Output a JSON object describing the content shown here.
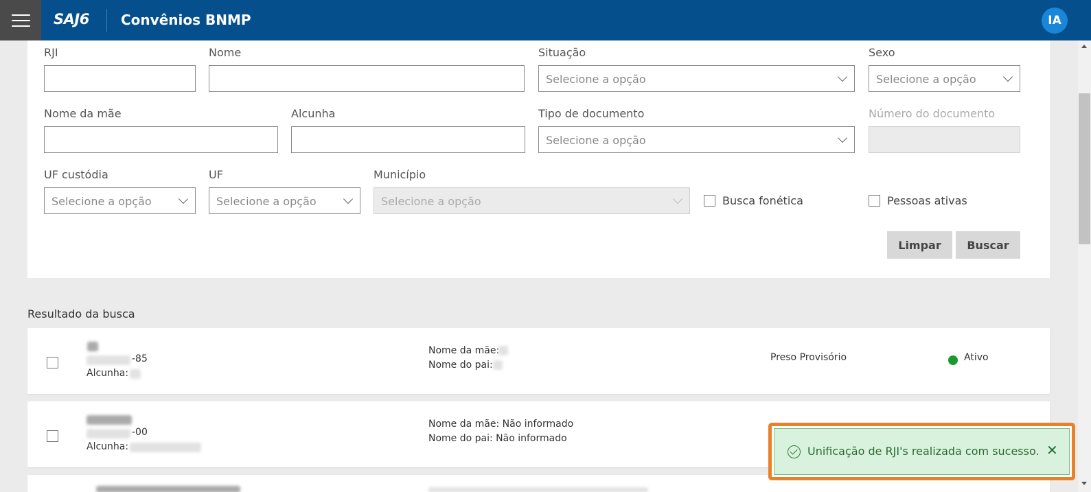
{
  "header": {
    "logo": "SAJ6",
    "title": "Convênios BNMP",
    "avatar_initials": "IA"
  },
  "filters": {
    "rji_label": "RJI",
    "nome_label": "Nome",
    "situacao_label": "Situação",
    "situacao_value": "Selecione a opção",
    "sexo_label": "Sexo",
    "sexo_value": "Selecione a opção",
    "nome_mae_label": "Nome da mãe",
    "alcunha_label": "Alcunha",
    "tipo_documento_label": "Tipo de documento",
    "tipo_documento_value": "Selecione a opção",
    "numero_documento_label": "Número do documento",
    "uf_custodia_label": "UF custódia",
    "uf_custodia_value": "Selecione a opção",
    "uf_label": "UF",
    "uf_value": "Selecione a opção",
    "municipio_label": "Município",
    "municipio_value": "Selecione a opção",
    "busca_fonetica_label": "Busca fonética",
    "pessoas_ativas_label": "Pessoas ativas",
    "limpar_label": "Limpar",
    "buscar_label": "Buscar"
  },
  "results": {
    "title": "Resultado da busca",
    "rows": [
      {
        "rji_suffix": "-85",
        "alcunha_label": "Alcunha:",
        "nome_mae": "Nome da mãe:",
        "nome_pai": "Nome do pai:",
        "situacao": "Preso Provisório",
        "status": "Ativo"
      },
      {
        "rji_suffix": "-00",
        "alcunha_label": "Alcunha:",
        "nome_mae": "Nome da mãe: Não informado",
        "nome_pai": "Nome do pai: Não informado"
      }
    ]
  },
  "toast": {
    "message": "Unificação de RJI's realizada com sucesso.",
    "close_glyph": "✕"
  },
  "colors": {
    "header_bg": "#05508c",
    "avatar_bg": "#1a86d8",
    "status_active": "#1a9a2e",
    "toast_bg": "#d9f2dd",
    "toast_highlight": "#e8822a"
  }
}
